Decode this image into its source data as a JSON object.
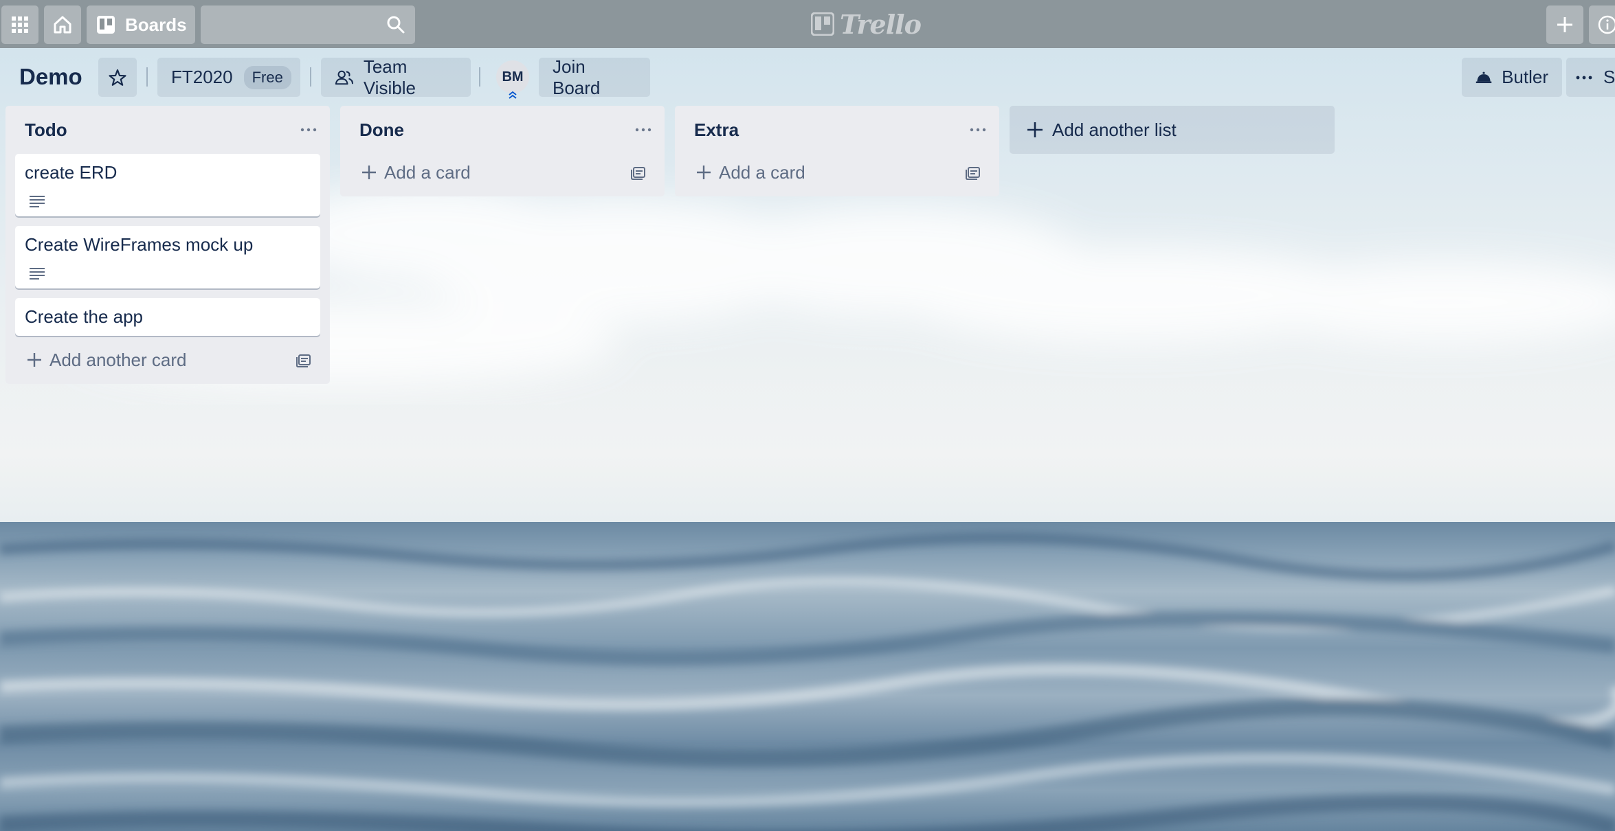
{
  "header": {
    "boards_label": "Boards",
    "search_placeholder": "",
    "logo_text": "Trello",
    "icons": [
      "apps-grid-icon",
      "home-icon",
      "boards-icon",
      "search-icon",
      "plus-icon",
      "info-icon"
    ]
  },
  "board": {
    "title": "Demo",
    "team_name": "FT2020",
    "team_badge": "Free",
    "visibility_label": "Team Visible",
    "member_initials": "BM",
    "join_label": "Join Board",
    "butler_label": "Butler",
    "show_menu_label": "S"
  },
  "lists": [
    {
      "title": "Todo",
      "cards": [
        {
          "title": "create ERD",
          "has_description": true
        },
        {
          "title": "Create WireFrames mock up",
          "has_description": true
        },
        {
          "title": "Create the app",
          "has_description": false
        }
      ],
      "add_label": "Add another card"
    },
    {
      "title": "Done",
      "cards": [],
      "add_label": "Add a card"
    },
    {
      "title": "Extra",
      "cards": [],
      "add_label": "Add a card"
    }
  ],
  "add_list_label": "Add another list",
  "colors": {
    "header_bg": "#7a8286",
    "list_bg": "#ebecf0",
    "text_primary": "#172b4d",
    "text_secondary": "#5e6c84"
  }
}
